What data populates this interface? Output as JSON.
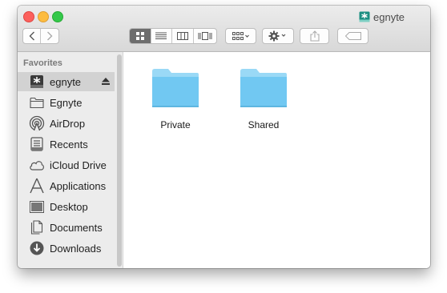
{
  "window": {
    "title": "egnyte"
  },
  "toolbar": {
    "nav": [
      "back-icon",
      "forward-icon"
    ],
    "view_modes": [
      "icon-view-icon",
      "list-view-icon",
      "column-view-icon",
      "coverflow-view-icon"
    ],
    "arrange": "arrange-icon",
    "action": "gear-icon",
    "share": "share-icon",
    "tags": "tag-icon"
  },
  "sidebar": {
    "header": "Favorites",
    "items": [
      {
        "label": "egnyte",
        "icon": "egnyte-drive-icon",
        "selected": true,
        "eject": true
      },
      {
        "label": "Egnyte",
        "icon": "folder-icon"
      },
      {
        "label": "AirDrop",
        "icon": "airdrop-icon"
      },
      {
        "label": "Recents",
        "icon": "recents-icon"
      },
      {
        "label": "iCloud Drive",
        "icon": "cloud-icon"
      },
      {
        "label": "Applications",
        "icon": "applications-icon"
      },
      {
        "label": "Desktop",
        "icon": "desktop-icon"
      },
      {
        "label": "Documents",
        "icon": "documents-icon"
      },
      {
        "label": "Downloads",
        "icon": "downloads-icon"
      }
    ]
  },
  "files": [
    {
      "name": "Private",
      "icon": "folder-icon"
    },
    {
      "name": "Shared",
      "icon": "folder-icon"
    }
  ],
  "colors": {
    "folder": "#71c8f2",
    "folder_tab": "#9ad9f6",
    "egnyte_brand": "#1b8f82"
  }
}
